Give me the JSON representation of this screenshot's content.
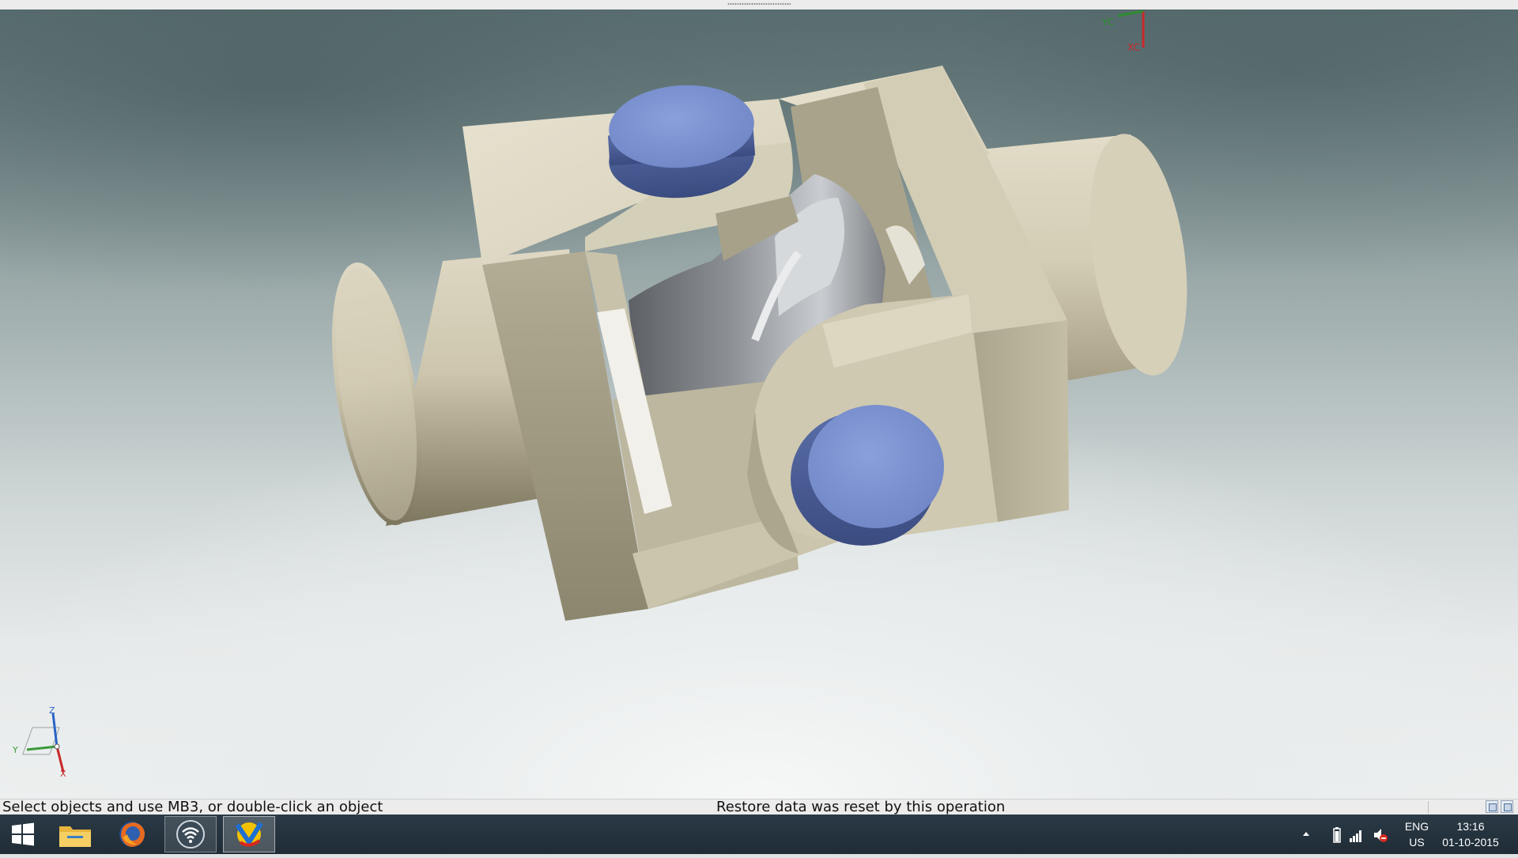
{
  "window": {
    "top_strip": ""
  },
  "viewport": {
    "wcs_labels": {
      "yc": "YC",
      "xc": "XC"
    },
    "triad_labels": {
      "z": "Z",
      "y": "Y",
      "x": "X"
    },
    "model": "universal-joint-3d-model"
  },
  "status_bar": {
    "prompt": "Select objects and use MB3, or double-click an object",
    "message": "Restore data was reset by this operation"
  },
  "taskbar": {
    "apps": [
      {
        "icon": "windows-start-icon",
        "label": "Start"
      },
      {
        "icon": "file-explorer-icon",
        "label": "File Explorer"
      },
      {
        "icon": "firefox-icon",
        "label": "Firefox"
      },
      {
        "icon": "wifi-app-icon",
        "label": "Network"
      },
      {
        "icon": "nx-cad-icon",
        "label": "NX"
      }
    ],
    "tray": {
      "lang_top": "ENG",
      "lang_bottom": "US",
      "time": "13:16",
      "date": "01-10-2015"
    }
  },
  "colors": {
    "body": "#d8d2bb",
    "pin": "#6f86c8",
    "cross": "#b9bdc2",
    "taskbar": "#24323d"
  }
}
